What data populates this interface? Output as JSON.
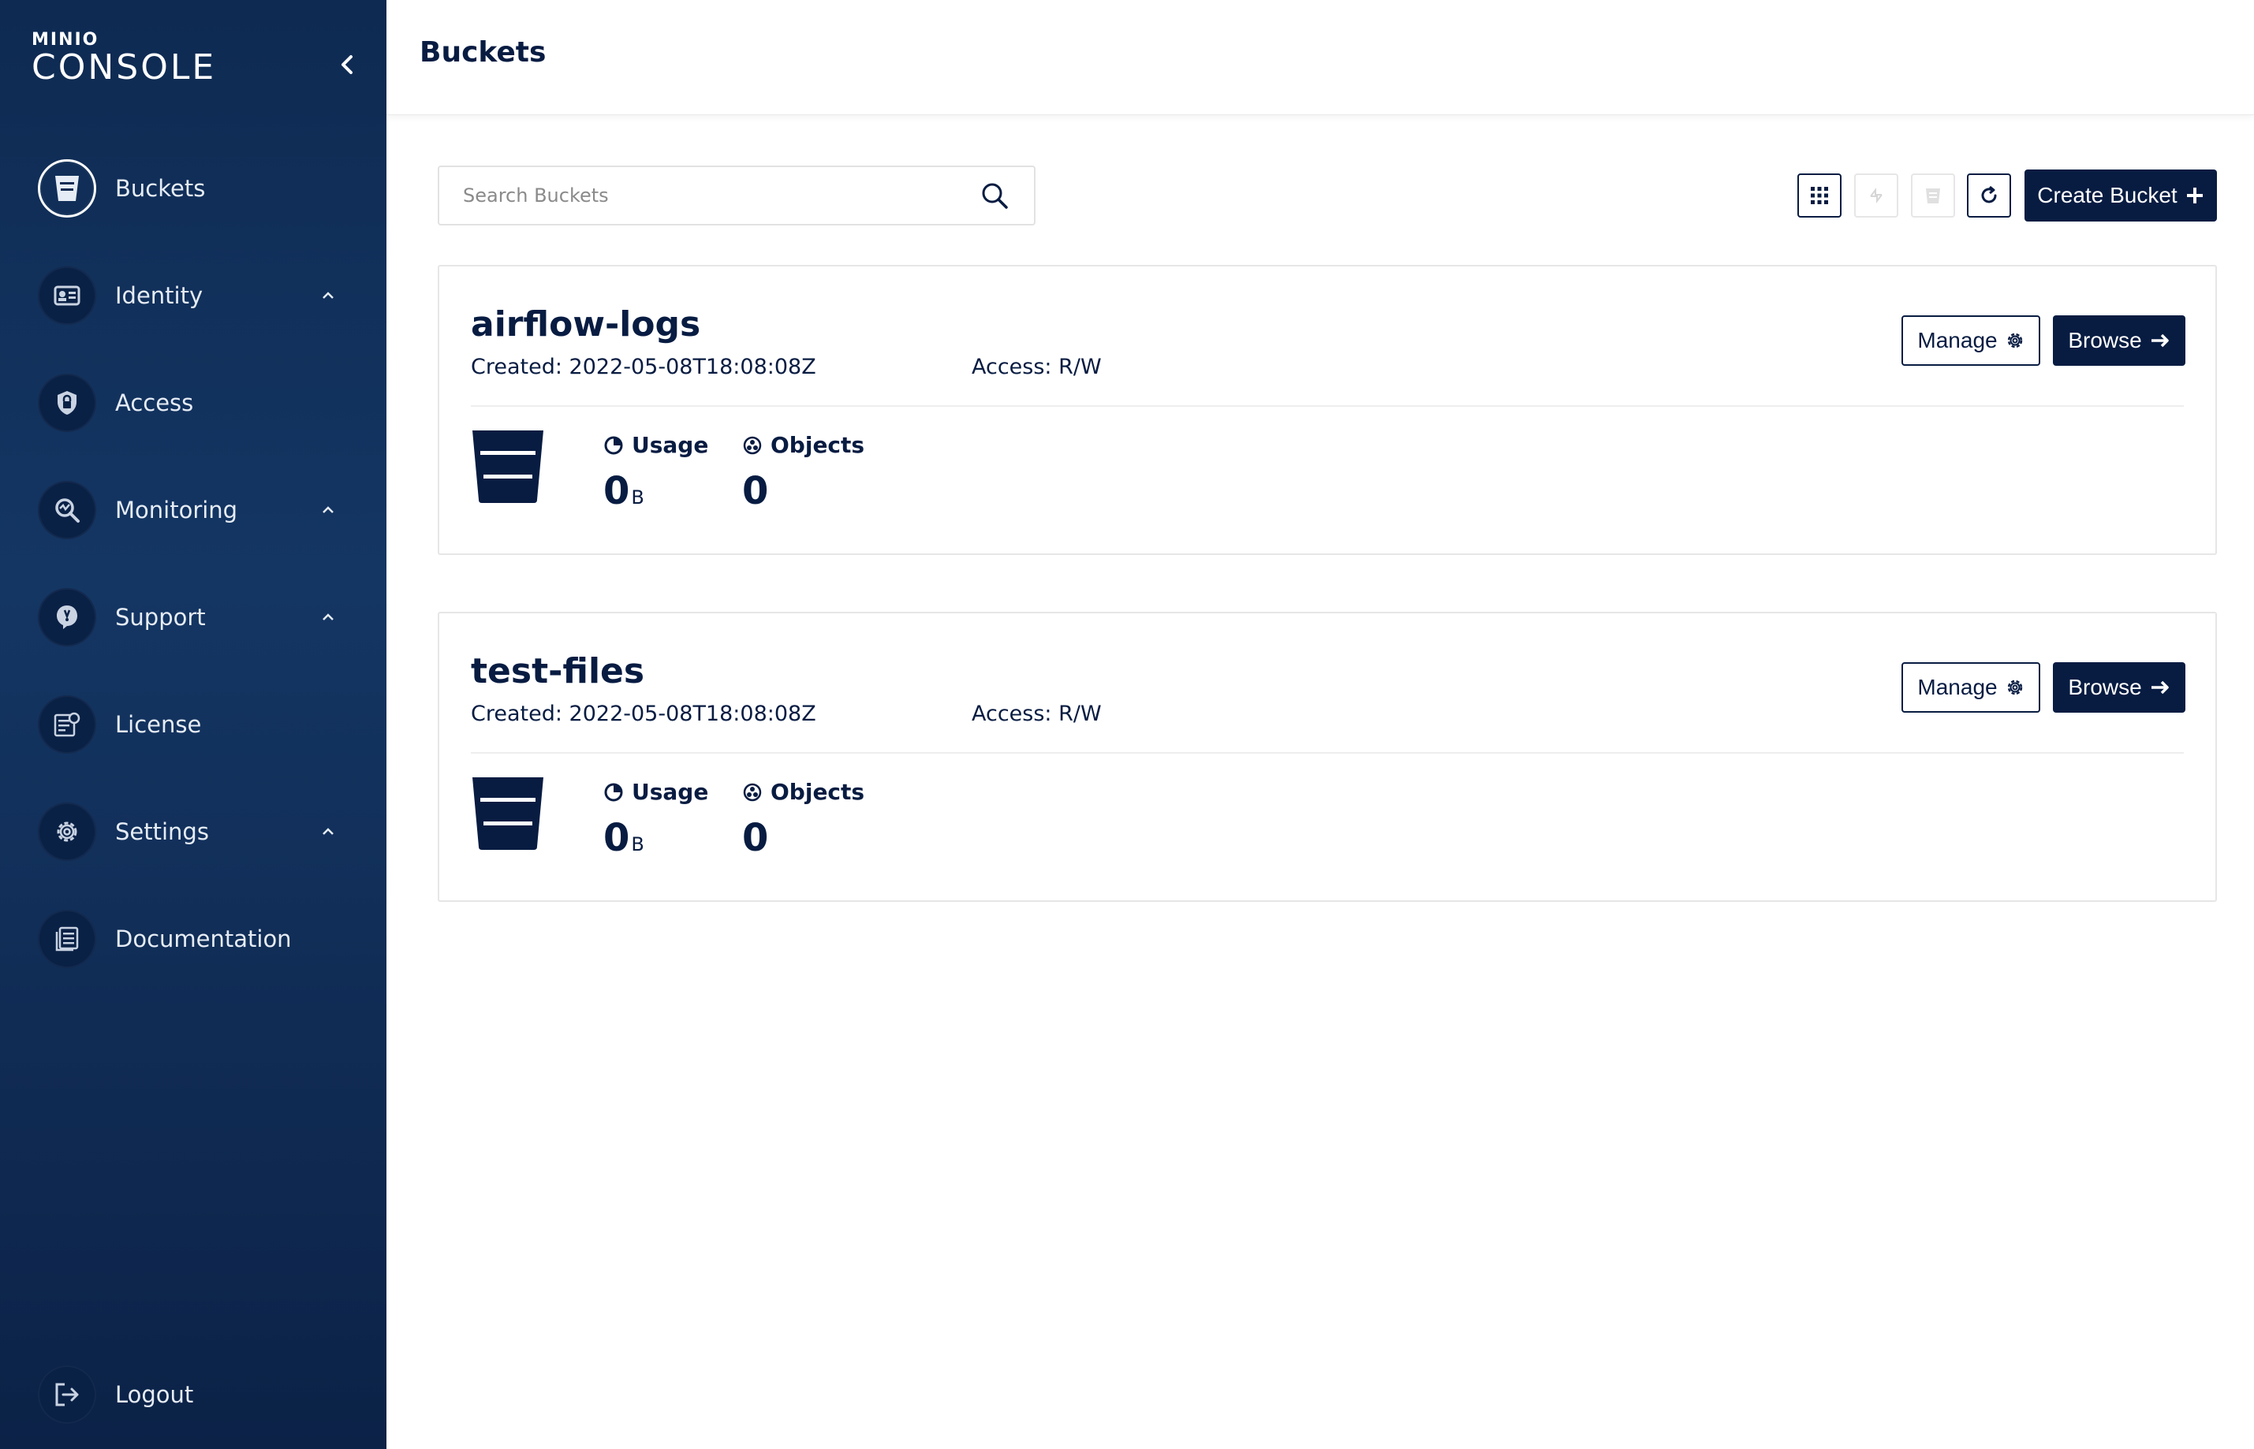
{
  "app": {
    "logo_top": "MINIO",
    "logo_bottom": "CONSOLE"
  },
  "sidebar": {
    "items": [
      {
        "label": "Buckets",
        "icon": "bucket-icon",
        "active": true
      },
      {
        "label": "Identity",
        "icon": "id-card-icon",
        "expandable": true
      },
      {
        "label": "Access",
        "icon": "lock-shield-icon"
      },
      {
        "label": "Monitoring",
        "icon": "monitoring-icon",
        "expandable": true
      },
      {
        "label": "Support",
        "icon": "support-icon",
        "expandable": true
      },
      {
        "label": "License",
        "icon": "license-icon"
      },
      {
        "label": "Settings",
        "icon": "gear-icon",
        "expandable": true
      },
      {
        "label": "Documentation",
        "icon": "documentation-icon"
      }
    ],
    "logout_label": "Logout"
  },
  "header": {
    "title": "Buckets"
  },
  "toolbar": {
    "search_placeholder": "Search Buckets",
    "create_label": "Create Bucket"
  },
  "buckets": [
    {
      "name": "airflow-logs",
      "created": "Created: 2022-05-08T18:08:08Z",
      "access": "Access: R/W",
      "usage_label": "Usage",
      "usage_value": "0",
      "usage_unit": "B",
      "objects_label": "Objects",
      "objects_value": "0",
      "manage_label": "Manage",
      "browse_label": "Browse"
    },
    {
      "name": "test-files",
      "created": "Created: 2022-05-08T18:08:08Z",
      "access": "Access: R/W",
      "usage_label": "Usage",
      "usage_value": "0",
      "usage_unit": "B",
      "objects_label": "Objects",
      "objects_value": "0",
      "manage_label": "Manage",
      "browse_label": "Browse"
    }
  ],
  "colors": {
    "primary": "#081c42",
    "sidebar_top": "#0e2a52",
    "sidebar_bottom": "#0c2247",
    "border": "#e6e6e6"
  }
}
